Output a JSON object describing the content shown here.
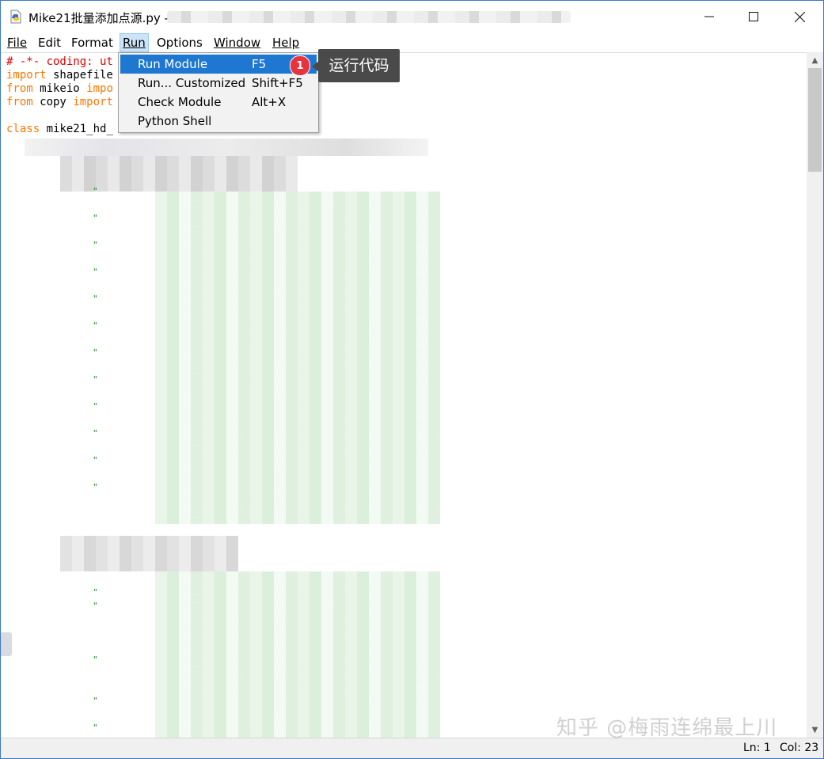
{
  "window": {
    "title": "Mike21批量添加点源.py -"
  },
  "menubar": {
    "items": [
      {
        "id": "file",
        "label": "File"
      },
      {
        "id": "edit",
        "label": "Edit"
      },
      {
        "id": "format",
        "label": "Format"
      },
      {
        "id": "run",
        "label": "Run"
      },
      {
        "id": "options",
        "label": "Options"
      },
      {
        "id": "window",
        "label": "Window"
      },
      {
        "id": "help",
        "label": "Help"
      }
    ],
    "active": "Run"
  },
  "run_menu": {
    "items": [
      {
        "label": "Run Module",
        "shortcut": "F5"
      },
      {
        "label": "Run... Customized",
        "shortcut": "Shift+F5"
      },
      {
        "label": "Check Module",
        "shortcut": "Alt+X"
      },
      {
        "label": "Python Shell",
        "shortcut": ""
      }
    ],
    "highlighted": "Run Module"
  },
  "callout": {
    "badge": "1",
    "text": "运行代码"
  },
  "code": {
    "line1": "# -*- coding: ut",
    "line2_kw": "import",
    "line2_rest": " shapefile",
    "line3_kw1": "from",
    "line3_mid": " mikeio ",
    "line3_kw2": "impo",
    "line4_kw1": "from",
    "line4_mid": " copy ",
    "line4_kw2": "import",
    "line6_kw": "class",
    "line6_rest": " mike21_hd_"
  },
  "statusbar": {
    "ln": "Ln: 1",
    "col": "Col: 23"
  },
  "watermark": "知乎 @梅雨连绵最上川",
  "colors": {
    "keyword": "#ff7700",
    "comment": "#dd0000",
    "menu_highlight": "#1e78d2",
    "badge": "#e8333d",
    "callout_bg": "#4a4a4a"
  },
  "icons": [
    "python-file-icon",
    "minimize-icon",
    "maximize-icon",
    "close-icon",
    "scroll-up-icon",
    "scroll-down-icon"
  ]
}
